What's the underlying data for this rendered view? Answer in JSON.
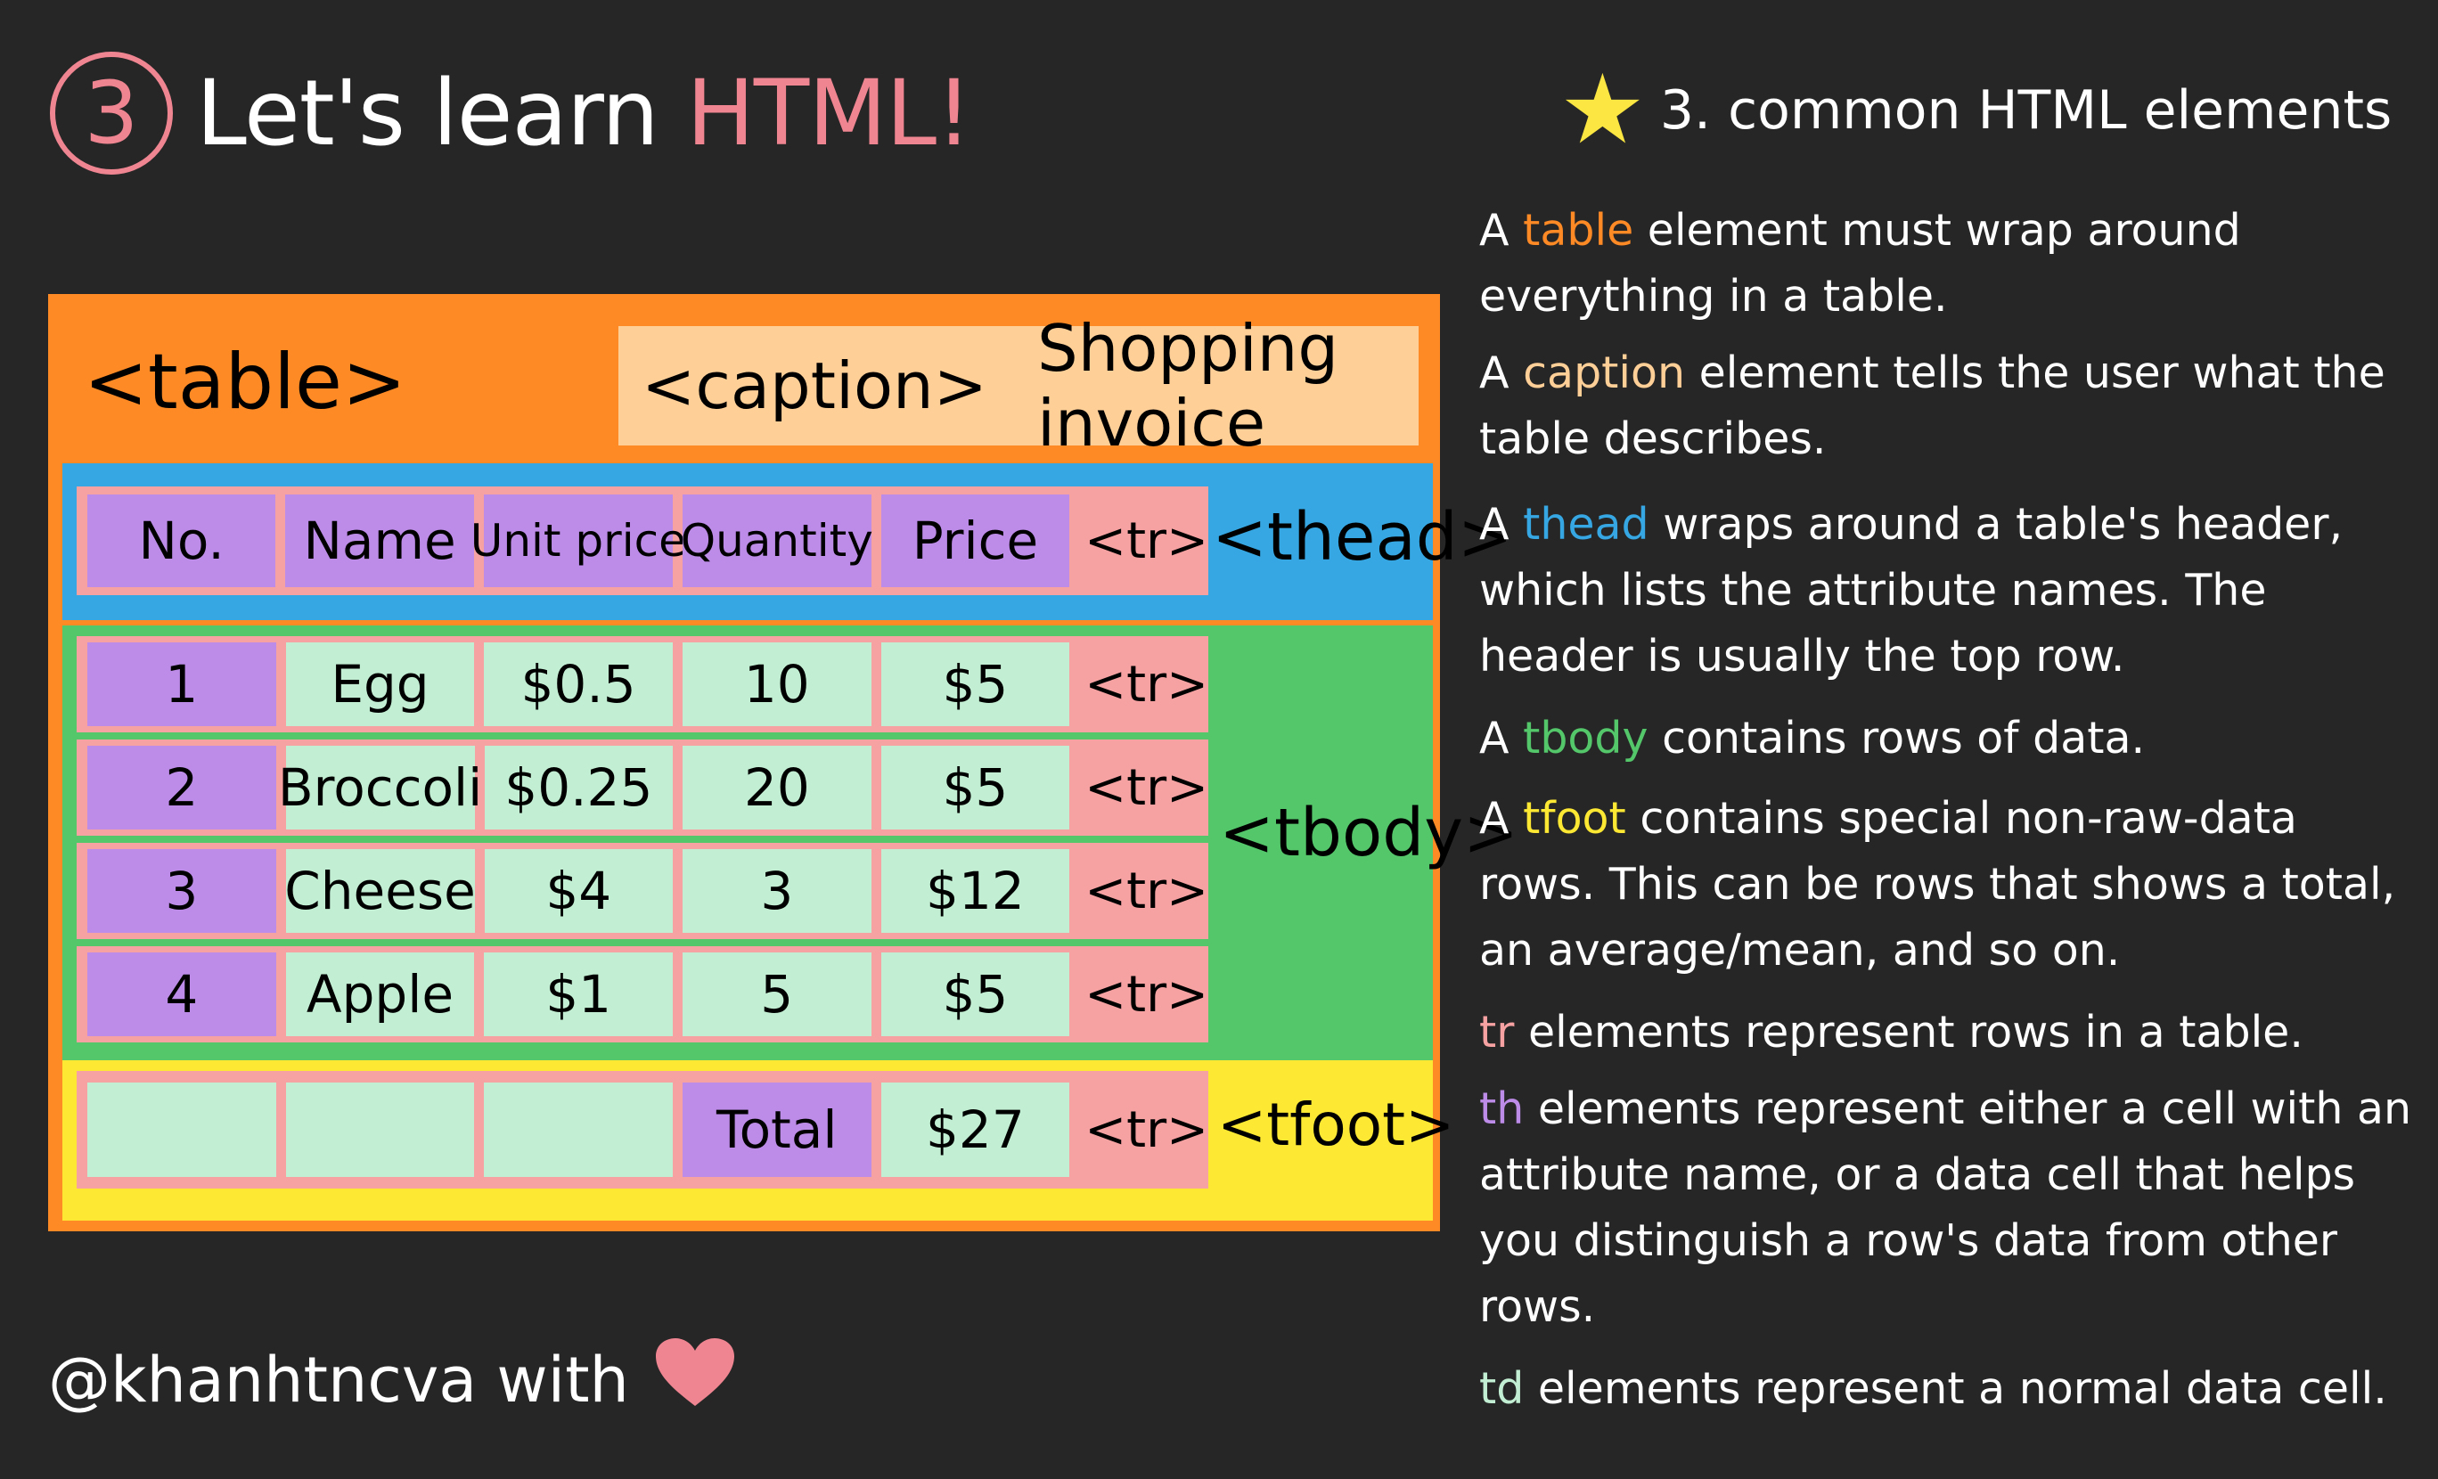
{
  "header": {
    "number": "3",
    "title_prefix": "Let's learn",
    "title_highlight": "HTML!"
  },
  "diagram": {
    "table_tag": "<table>",
    "caption_tag": "<caption>",
    "caption_text": "Shopping invoice",
    "thead_tag": "<thead>",
    "tbody_tag": "<tbody>",
    "tfoot_tag": "<tfoot>",
    "tr_tag": "<tr>",
    "header_row": [
      "No.",
      "Name",
      "Unit price",
      "Quantity",
      "Price"
    ],
    "body_rows": [
      [
        "1",
        "Egg",
        "$0.5",
        "10",
        "$5"
      ],
      [
        "2",
        "Broccoli",
        "$0.25",
        "20",
        "$5"
      ],
      [
        "3",
        "Cheese",
        "$4",
        "3",
        "$12"
      ],
      [
        "4",
        "Apple",
        "$1",
        "5",
        "$5"
      ]
    ],
    "foot_row": [
      "",
      "",
      "",
      "Total",
      "$27"
    ]
  },
  "notes": {
    "heading": "3. common HTML elements",
    "table": {
      "pre": "A",
      "key": "table",
      "post": "element must wrap around everything in a table."
    },
    "caption": {
      "pre": "A",
      "key": "caption",
      "post": "element tells the user what the table describes."
    },
    "thead": {
      "pre": "A",
      "key": "thead",
      "post": "wraps around a table's header, which lists the attribute names. The header is usually the top row."
    },
    "tbody": {
      "pre": "A",
      "key": "tbody",
      "post": "contains rows of data."
    },
    "tfoot": {
      "pre": "A",
      "key": "tfoot",
      "post": "contains special non-raw-data rows. This can be rows that shows a total, an average/mean, and so on."
    },
    "tr": {
      "key": "tr",
      "post": "elements represent rows in a table."
    },
    "th": {
      "key": "th",
      "post": "elements represent either a cell with an attribute name, or a data cell that helps you distinguish a row's data from other rows."
    },
    "td": {
      "key": "td",
      "post": "elements represent a normal data cell."
    }
  },
  "footer": {
    "handle": "@khanhtncva with"
  },
  "icons": {
    "star": "star-icon",
    "heart": "heart-icon"
  },
  "colors": {
    "table": "#fe8a26",
    "caption": "#ffcf98",
    "thead": "#36a7e2",
    "tbody": "#54c76b",
    "tfoot": "#fde833",
    "tr": "#f6a1a2",
    "th": "#bd8ce8",
    "td": "#c2efd3",
    "title_accent": "#f08592"
  }
}
